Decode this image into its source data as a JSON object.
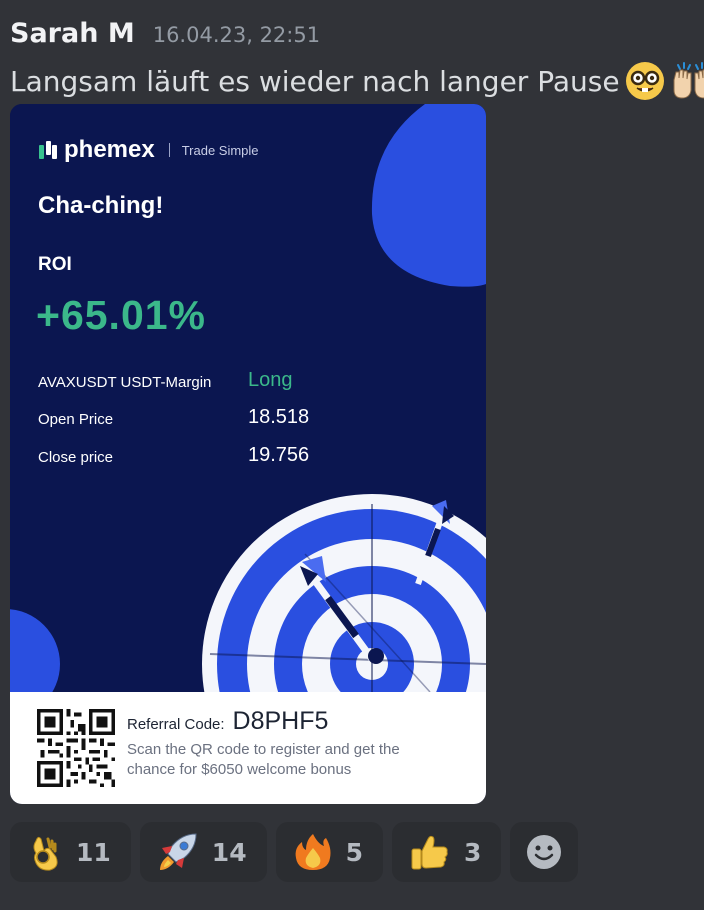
{
  "message": {
    "username": "Sarah M",
    "timestamp": "16.04.23, 22:51",
    "text": "Langsam läuft es wieder nach langer Pause"
  },
  "card": {
    "brand": "phemex",
    "tagline": "Trade Simple",
    "headline": "Cha-ching!",
    "roi_label": "ROI",
    "roi_value": "+65.01%",
    "rows": [
      {
        "label": "AVAXUSDT USDT-Margin",
        "value": "Long"
      },
      {
        "label": "Open Price",
        "value": "18.518"
      },
      {
        "label": "Close price",
        "value": "19.756"
      }
    ],
    "referral_label": "Referral Code:",
    "referral_code": "D8PHF5",
    "referral_desc": "Scan the QR code to register and get the chance for $6050 welcome bonus"
  },
  "reactions": [
    {
      "icon": "ok-hand-icon",
      "count": "11"
    },
    {
      "icon": "rocket-icon",
      "count": "14"
    },
    {
      "icon": "fire-icon",
      "count": "5"
    },
    {
      "icon": "thumbs-up-icon",
      "count": "3"
    }
  ],
  "colors": {
    "background": "#313338",
    "card_blue": "#0b1650",
    "accent_blue": "#2a4fe0",
    "positive_green": "#3bb88a"
  }
}
